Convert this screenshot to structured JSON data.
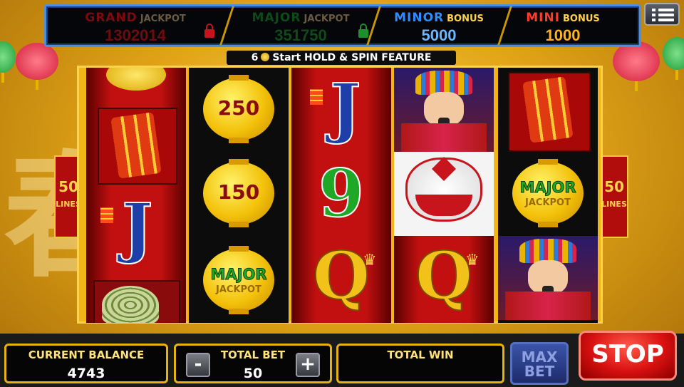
{
  "jackpots": [
    {
      "word": "GRAND",
      "suffix": "JACKPOT",
      "value": "1302014",
      "color": "#c4141c",
      "locked": true
    },
    {
      "word": "MAJOR",
      "suffix": "JACKPOT",
      "value": "351750",
      "color": "#1d8f2b",
      "locked": true
    },
    {
      "word": "MINOR",
      "suffix": "BONUS",
      "value": "5000",
      "color": "#1d6fe8",
      "locked": false
    },
    {
      "word": "MINI",
      "suffix": "BONUS",
      "value": "1000",
      "color": "#ff2f1f",
      "locked": false
    }
  ],
  "feature": {
    "count": "6",
    "text": "Start HOLD & SPIN FEATURE"
  },
  "lines": {
    "number": "50",
    "label": "LINES"
  },
  "reel2": {
    "top": "250",
    "mid": "150",
    "bottom_word": "MAJOR",
    "bottom_sub": "JACKPOT"
  },
  "reel3": {
    "top": "J",
    "mid": "9",
    "bottom": "Q"
  },
  "reel4": {
    "bottom": "Q"
  },
  "reel5": {
    "mid_word": "MAJOR",
    "mid_sub": "JACKPOT"
  },
  "reel1": {
    "mid": "J"
  },
  "bottom": {
    "balance_label": "CURRENT BALANCE",
    "balance": "4743",
    "bet_label": "TOTAL BET",
    "bet": "50",
    "minus": "-",
    "plus": "+",
    "win_label": "TOTAL WIN",
    "win": "",
    "maxbet": "MAX BET",
    "stop": "STOP"
  },
  "colors": {
    "gold": "#f2b516",
    "red": "#c21010",
    "blue": "#1f3fa8",
    "green": "#1fa827"
  }
}
